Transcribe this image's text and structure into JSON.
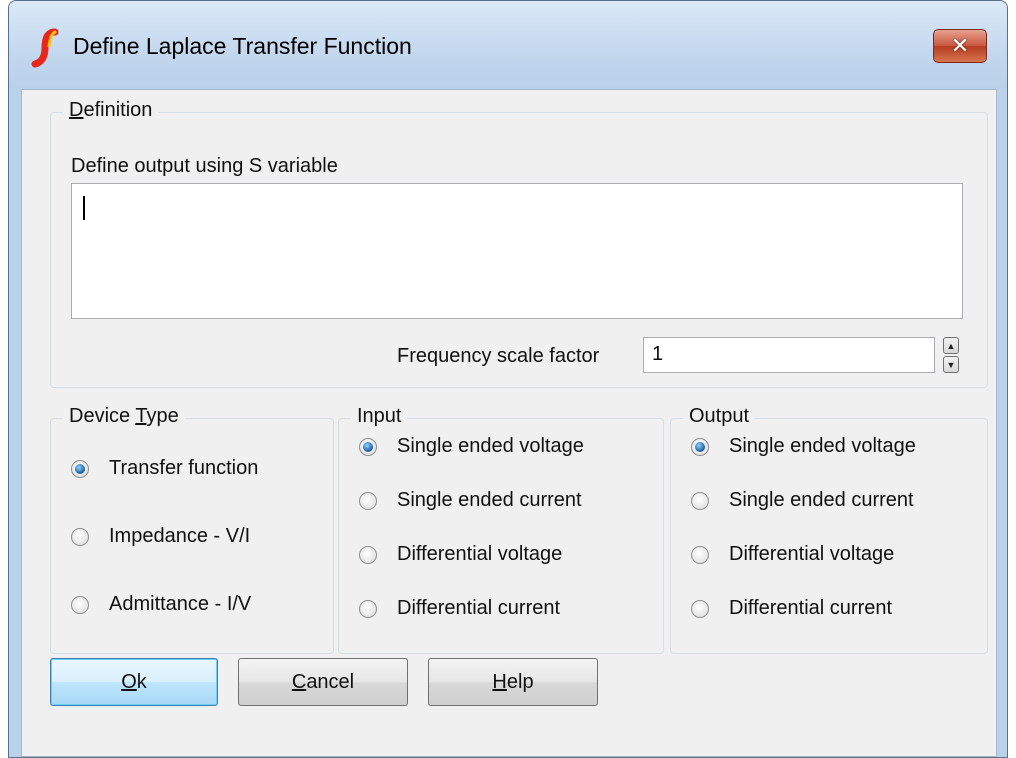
{
  "window": {
    "title": "Define Laplace Transfer Function",
    "close_label": "✕"
  },
  "definition": {
    "group_label_first": "D",
    "group_label_rest": "efinition",
    "prompt": "Define output using S variable",
    "expression_value": "",
    "freq_label": "Frequency scale factor",
    "freq_value": "1"
  },
  "device_type": {
    "label_before": "Device ",
    "label_underline": "T",
    "label_after": "ype",
    "options": [
      {
        "label": "Transfer function",
        "checked": true
      },
      {
        "label": "Impedance - V/I",
        "checked": false
      },
      {
        "label": "Admittance - I/V",
        "checked": false
      }
    ]
  },
  "input": {
    "label": "Input",
    "options": [
      {
        "label": "Single ended voltage",
        "checked": true
      },
      {
        "label": "Single ended current",
        "checked": false
      },
      {
        "label": "Differential voltage",
        "checked": false
      },
      {
        "label": "Differential current",
        "checked": false
      }
    ]
  },
  "output": {
    "label": "Output",
    "options": [
      {
        "label": "Single ended voltage",
        "checked": true
      },
      {
        "label": "Single ended current",
        "checked": false
      },
      {
        "label": "Differential voltage",
        "checked": false
      },
      {
        "label": "Differential current",
        "checked": false
      }
    ]
  },
  "buttons": {
    "ok_first": "O",
    "ok_rest": "k",
    "cancel_first": "C",
    "cancel_rest": "ancel",
    "help_first": "H",
    "help_rest": "elp"
  },
  "colors": {
    "window_frame": "#b9d1ea",
    "client_bg": "#f0f0f0",
    "close_button": "#c8563e",
    "default_button_border": "#3c7fb1"
  },
  "icons": [
    "app-logo-icon",
    "close-icon",
    "spin-up-icon",
    "spin-down-icon"
  ]
}
